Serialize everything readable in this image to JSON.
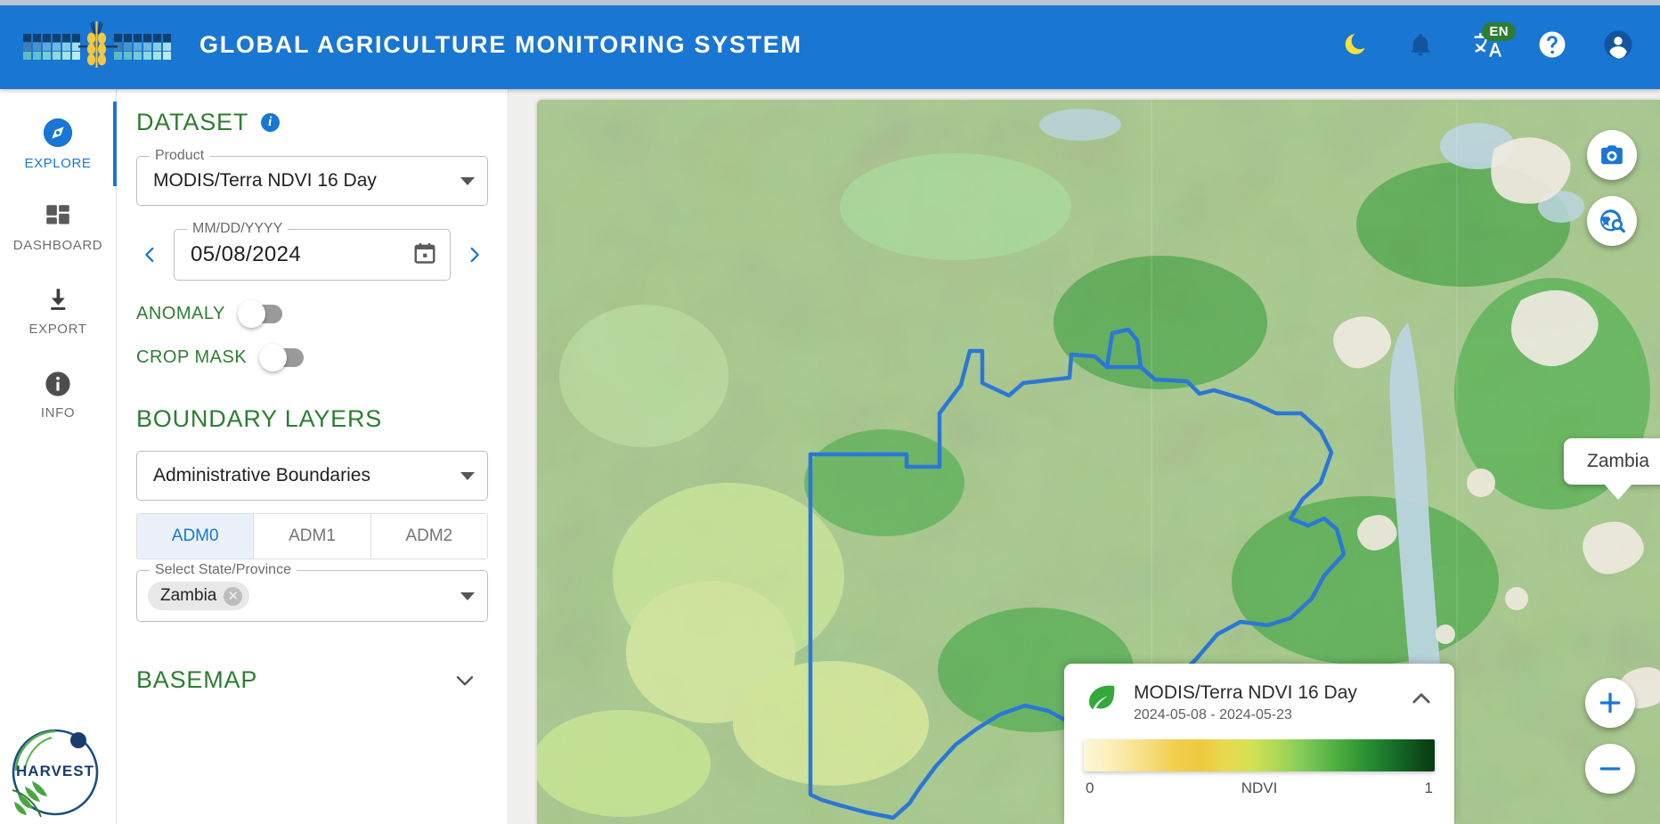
{
  "header": {
    "title": "GLOBAL AGRICULTURE MONITORING SYSTEM",
    "logo_name": "gams-logo",
    "brand_color": "#1976d2",
    "actions": [
      {
        "name": "dark-mode-toggle",
        "icon": "moon-icon",
        "label": ""
      },
      {
        "name": "notifications-button",
        "icon": "bell-icon",
        "label": ""
      },
      {
        "name": "language-button",
        "icon": "translate-icon",
        "label": "EN"
      },
      {
        "name": "help-button",
        "icon": "help-circle-icon",
        "label": ""
      },
      {
        "name": "account-button",
        "icon": "account-circle-icon",
        "label": ""
      }
    ],
    "language_code": "EN",
    "language_badge_color": "#2e7d32"
  },
  "rail": {
    "items": [
      {
        "label": "EXPLORE",
        "icon": "compass-icon",
        "active": true
      },
      {
        "label": "DASHBOARD",
        "icon": "dashboard-icon",
        "active": false
      },
      {
        "label": "EXPORT",
        "icon": "download-icon",
        "active": false
      },
      {
        "label": "INFO",
        "icon": "info-circle-icon",
        "active": false
      }
    ],
    "active_color": "#1976d2"
  },
  "panel": {
    "dataset": {
      "heading": "DATASET",
      "product": {
        "legend": "Product",
        "value": "MODIS/Terra NDVI 16 Day"
      },
      "date": {
        "legend": "MM/DD/YYYY",
        "value": "05/08/2024",
        "prev_label": "",
        "next_label": ""
      },
      "toggles": [
        {
          "label": "ANOMALY",
          "on": false
        },
        {
          "label": "CROP MASK",
          "on": false
        }
      ]
    },
    "boundary": {
      "heading": "BOUNDARY LAYERS",
      "layer": {
        "legend": "",
        "value": "Administrative Boundaries"
      },
      "adm_tabs": [
        {
          "label": "ADM0",
          "active": true
        },
        {
          "label": "ADM1",
          "active": false
        },
        {
          "label": "ADM2",
          "active": false
        }
      ],
      "province": {
        "legend": "Select State/Province",
        "chips": [
          "Zambia"
        ]
      }
    },
    "basemap": {
      "heading": "BASEMAP"
    },
    "heading_color": "#2e7d32"
  },
  "map": {
    "country_tooltip": "Zambia",
    "boundary_color": "#2b77d6",
    "controls": [
      {
        "name": "screenshot-button",
        "icon": "camera-icon"
      },
      {
        "name": "travel-explore-button",
        "icon": "globe-search-icon"
      },
      {
        "name": "zoom-in-button",
        "icon": "plus-icon"
      },
      {
        "name": "zoom-out-button",
        "icon": "minus-icon"
      }
    ],
    "legend": {
      "icon": "leaf-icon",
      "title": "MODIS/Terra NDVI 16 Day",
      "date_range": "2024-05-08 - 2024-05-23",
      "scale_min": "0",
      "scale_label": "NDVI",
      "scale_max": "1"
    }
  },
  "footer": {
    "logo_name": "harvest-logo",
    "logo_text": "HARVEST"
  }
}
